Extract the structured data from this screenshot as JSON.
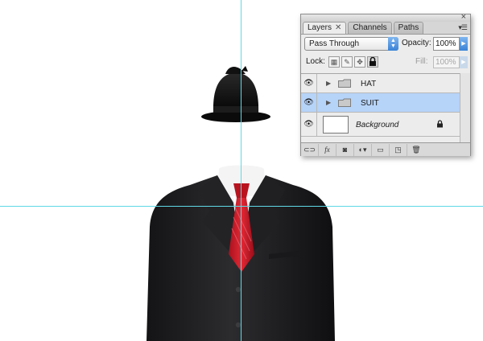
{
  "panel": {
    "tabs": [
      {
        "label": "Layers",
        "active": true,
        "close_glyph": "✕"
      },
      {
        "label": "Channels",
        "active": false
      },
      {
        "label": "Paths",
        "active": false
      }
    ],
    "close_glyph": "×",
    "menu_glyph": "▾☰",
    "blend_mode": "Pass Through",
    "opacity_label": "Opacity:",
    "opacity_value": "100%",
    "lock_label": "Lock:",
    "lock_icons": [
      "lock-transparent-icon",
      "lock-image-icon",
      "lock-position-icon",
      "lock-all-icon"
    ],
    "fill_label": "Fill:",
    "fill_value": "100%",
    "layers": [
      {
        "name": "HAT",
        "type": "group",
        "visible": true,
        "selected": false,
        "collapsed": true
      },
      {
        "name": "SUIT",
        "type": "group",
        "visible": true,
        "selected": true,
        "collapsed": true
      },
      {
        "name": "Background",
        "type": "layer",
        "visible": true,
        "selected": false,
        "locked": true
      }
    ],
    "bottom_buttons": [
      "link-layers-icon",
      "fx-icon",
      "add-mask-icon",
      "adjustment-layer-icon",
      "new-group-icon",
      "new-layer-icon",
      "trash-icon"
    ],
    "bottom_labels": {
      "fx": "fx"
    }
  },
  "colors": {
    "guide": "#5fd9e6",
    "selection": "#b6d3f8",
    "tie": "#d01c2a",
    "suit": "#1f1f21"
  }
}
